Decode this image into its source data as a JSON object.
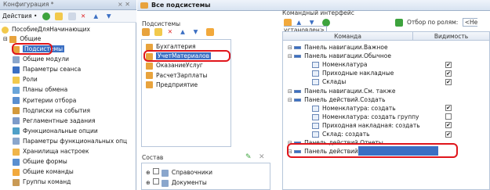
{
  "config_title": "Конфигурация *",
  "actions_label": "Действия •",
  "tree": {
    "root": "ПособиеДляНачинающих",
    "common": "Общие",
    "items": [
      "Подсистемы",
      "Общие модули",
      "Параметры сеанса",
      "Роли",
      "Планы обмена",
      "Критерии отбора",
      "Подписки на события",
      "Регламентные задания",
      "Функциональные опции",
      "Параметры функциональных опц",
      "Хранилища настроек",
      "Общие формы",
      "Общие команды",
      "Группы команд"
    ]
  },
  "window_title": "Все подсистемы",
  "subsystems": {
    "label": "Подсистемы",
    "items": [
      "Бухгалтерия",
      "УчетМатериалов",
      "ОказаниеУслуг",
      "РасчетЗарплаты",
      "Предприятие"
    ]
  },
  "composition": {
    "label": "Состав",
    "items": [
      "Справочники",
      "Документы"
    ]
  },
  "command_interface": {
    "label": "Командный интерфейс",
    "filter_label": "Отбор по ролям:",
    "filter_value": "<Не установлен>",
    "col_command": "Команда",
    "col_visibility": "Видимость",
    "rows": [
      {
        "text": "Панель навигации.Важное",
        "level": 0,
        "check": null
      },
      {
        "text": "Панель навигации.Обычное",
        "level": 0,
        "check": null
      },
      {
        "text": "Номенклатура",
        "level": 1,
        "check": true
      },
      {
        "text": "Приходные накладные",
        "level": 1,
        "check": true
      },
      {
        "text": "Склады",
        "level": 1,
        "check": true
      },
      {
        "text": "Панель навигации.См. также",
        "level": 0,
        "check": null
      },
      {
        "text": "Панель действий.Создать",
        "level": 0,
        "check": null
      },
      {
        "text": "Номенклатура: создать",
        "level": 1,
        "check": true
      },
      {
        "text": "Номенклатура: создать группу",
        "level": 1,
        "check": false
      },
      {
        "text": "Приходная накладная: создать",
        "level": 1,
        "check": true
      },
      {
        "text": "Склад: создать",
        "level": 1,
        "check": true
      },
      {
        "text": "Панель действий.Отчеты",
        "level": 0,
        "check": null
      },
      {
        "text": "Панель действий.Сервис",
        "level": 0,
        "check": null
      }
    ]
  },
  "colors": {
    "accent": "#3b6fc3",
    "highlight": "#e0151b"
  }
}
